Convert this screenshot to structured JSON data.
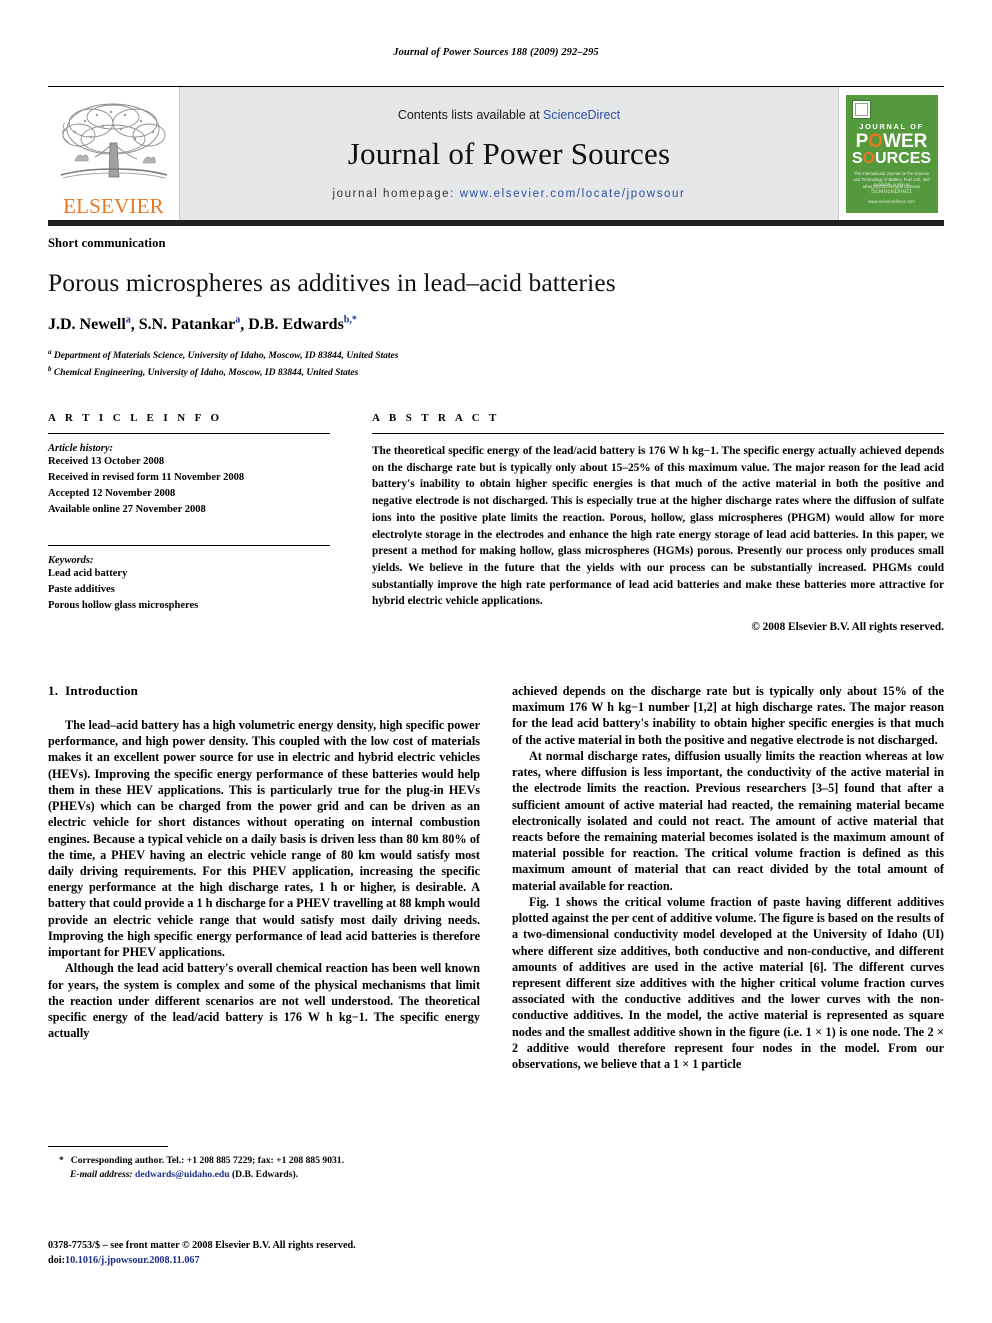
{
  "running_head": "Journal of Power Sources 188 (2009) 292–295",
  "masthead": {
    "contents_prefix": "Contents lists available at ",
    "sciencedirect": "ScienceDirect",
    "journal_title": "Journal of Power Sources",
    "homepage_label": "journal homepage:",
    "homepage_url": "www.elsevier.com/locate/jpowsour",
    "publisher": "ELSEVIER",
    "publisher_color": "#E87722",
    "cover": {
      "line1": "JOURNAL OF",
      "line2": "POWER",
      "line3": "SOURCES",
      "subtitle": "The International Journal on the Science and Technology of Battery, Fuel Cell, and other Electrochemical Systems",
      "sd_small": "Available online at",
      "sd_brand": "ScienceDirect",
      "sd_foot": "www.sciencedirect.com",
      "bg_color": "#55993d",
      "accent_color": "#e87722"
    }
  },
  "article": {
    "type": "Short communication",
    "title": "Porous microspheres as additives in lead–acid batteries",
    "authors": [
      {
        "name": "J.D. Newell",
        "sup": "a"
      },
      {
        "name": "S.N. Patankar",
        "sup": "a"
      },
      {
        "name": "D.B. Edwards",
        "sup": "b,*"
      }
    ],
    "authors_line": "J.D. Newell",
    "affiliations": [
      {
        "marker": "a",
        "text": "Department of Materials Science, University of Idaho, Moscow, ID 83844, United States"
      },
      {
        "marker": "b",
        "text": "Chemical Engineering, University of Idaho, Moscow, ID 83844, United States"
      }
    ]
  },
  "article_info": {
    "heading": "A R T I C L E   I N F O",
    "history_label": "Article history:",
    "history": [
      "Received 13 October 2008",
      "Received in revised form 11 November 2008",
      "Accepted 12 November 2008",
      "Available online 27 November 2008"
    ],
    "keywords_label": "Keywords:",
    "keywords": [
      "Lead acid battery",
      "Paste additives",
      "Porous hollow glass microspheres"
    ]
  },
  "abstract": {
    "heading": "A B S T R A C T",
    "text": "The theoretical specific energy of the lead/acid battery is 176 W h kg−1. The specific energy actually achieved depends on the discharge rate but is typically only about 15–25% of this maximum value. The major reason for the lead acid battery's inability to obtain higher specific energies is that much of the active material in both the positive and negative electrode is not discharged. This is especially true at the higher discharge rates where the diffusion of sulfate ions into the positive plate limits the reaction. Porous, hollow, glass microspheres (PHGM) would allow for more electrolyte storage in the electrodes and enhance the high rate energy storage of lead acid batteries. In this paper, we present a method for making hollow, glass microspheres (HGMs) porous. Presently our process only produces small yields. We believe in the future that the yields with our process can be substantially increased. PHGMs could substantially improve the high rate performance of lead acid batteries and make these batteries more attractive for hybrid electric vehicle applications.",
    "copyright": "© 2008 Elsevier B.V. All rights reserved."
  },
  "body": {
    "section_number": "1.",
    "section_title": "Introduction",
    "left_paragraphs": [
      "The lead–acid battery has a high volumetric energy density, high specific power performance, and high power density. This coupled with the low cost of materials makes it an excellent power source for use in electric and hybrid electric vehicles (HEVs). Improving the specific energy performance of these batteries would help them in these HEV applications. This is particularly true for the plug-in HEVs (PHEVs) which can be charged from the power grid and can be driven as an electric vehicle for short distances without operating on internal combustion engines. Because a typical vehicle on a daily basis is driven less than 80 km 80% of the time, a PHEV having an electric vehicle range of 80 km would satisfy most daily driving requirements. For this PHEV application, increasing the specific energy performance at the high discharge rates, 1 h or higher, is desirable. A battery that could provide a 1 h discharge for a PHEV travelling at 88 kmph would provide an electric vehicle range that would satisfy most daily driving needs. Improving the high specific energy performance of lead acid batteries is therefore important for PHEV applications.",
      "Although the lead acid battery's overall chemical reaction has been well known for years, the system is complex and some of the physical mechanisms that limit the reaction under different scenarios are not well understood. The theoretical specific energy of the lead/acid battery is 176 W h kg−1. The specific energy actually"
    ],
    "right_paragraphs": [
      "achieved depends on the discharge rate but is typically only about 15% of the maximum 176 W h kg−1 number [1,2] at high discharge rates. The major reason for the lead acid battery's inability to obtain higher specific energies is that much of the active material in both the positive and negative electrode is not discharged.",
      "At normal discharge rates, diffusion usually limits the reaction whereas at low rates, where diffusion is less important, the conductivity of the active material in the electrode limits the reaction. Previous researchers [3–5] found that after a sufficient amount of active material had reacted, the remaining material became electronically isolated and could not react. The amount of active material that reacts before the remaining material becomes isolated is the maximum amount of material possible for reaction. The critical volume fraction is defined as this maximum amount of material that can react divided by the total amount of material available for reaction.",
      "Fig. 1 shows the critical volume fraction of paste having different additives plotted against the per cent of additive volume. The figure is based on the results of a two-dimensional conductivity model developed at the University of Idaho (UI) where different size additives, both conductive and non-conductive, and different amounts of additives are used in the active material [6]. The different curves represent different size additives with the higher critical volume fraction curves associated with the conductive additives and the lower curves with the non-conductive additives. In the model, the active material is represented as square nodes and the smallest additive shown in the figure (i.e. 1 × 1) is one node. The 2 × 2 additive would therefore represent four nodes in the model. From our observations, we believe that a 1 × 1 particle"
    ]
  },
  "footnotes": {
    "corresponding": "Corresponding author. Tel.: +1 208 885 7229; fax: +1 208 885 9031.",
    "corresponding_star": "*",
    "email_label": "E-mail address:",
    "email": "dedwards@uidaho.edu",
    "email_owner": "(D.B. Edwards).",
    "issn_line": "0378-7753/$ – see front matter © 2008 Elsevier B.V. All rights reserved.",
    "doi_label": "doi:",
    "doi": "10.1016/j.jpowsour.2008.11.067"
  }
}
